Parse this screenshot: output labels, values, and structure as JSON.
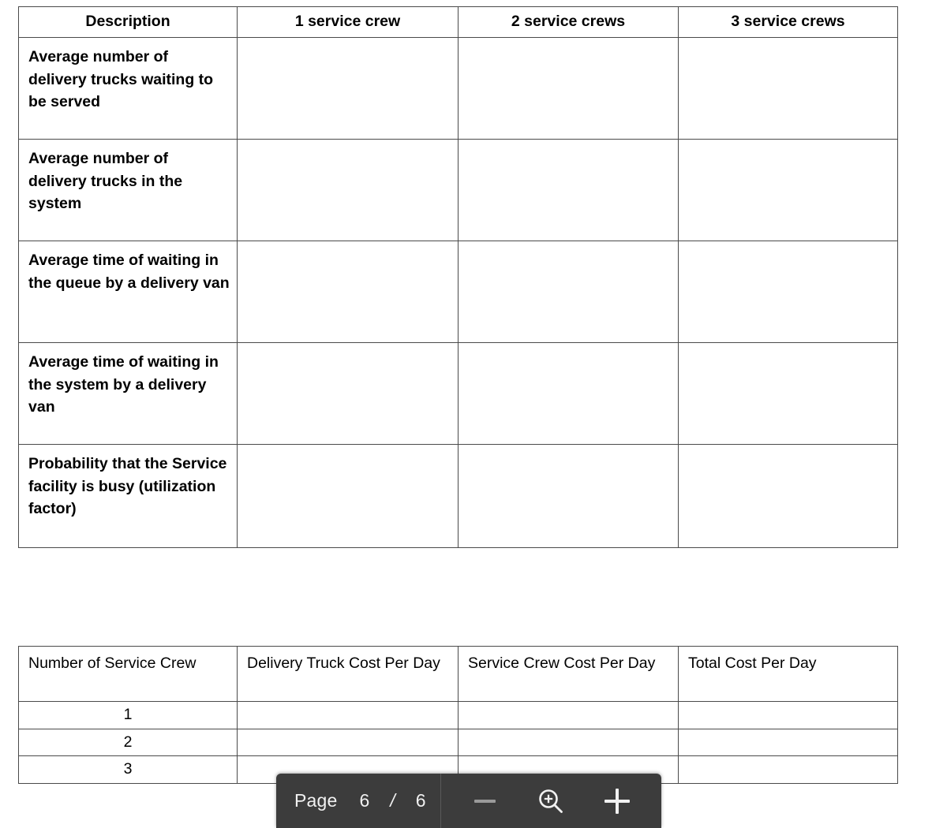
{
  "document": {
    "background_color": "#ffffff",
    "border_color": "#4a4a4a"
  },
  "metrics_table": {
    "name": "queueing-metrics-table",
    "headers": [
      "Description",
      "1 service crew",
      "2 service crews",
      "3 service crews"
    ],
    "rows": [
      {
        "description": "Average number of delivery trucks waiting to be served",
        "crew1": "",
        "crew2": "",
        "crew3": ""
      },
      {
        "description": "Average number of delivery trucks in the system",
        "crew1": "",
        "crew2": "",
        "crew3": ""
      },
      {
        "description": "Average time of waiting in the queue by a delivery van",
        "crew1": "",
        "crew2": "",
        "crew3": ""
      },
      {
        "description": "Average time of waiting in the system by a delivery van",
        "crew1": "",
        "crew2": "",
        "crew3": ""
      },
      {
        "description": "Probability that the Service facility is busy (utilization factor)",
        "crew1": "",
        "crew2": "",
        "crew3": ""
      }
    ]
  },
  "cost_table": {
    "name": "cost-comparison-table",
    "headers": [
      "Number of Service Crew",
      "Delivery Truck Cost Per Day",
      "Service Crew Cost Per Day",
      "Total Cost Per Day"
    ],
    "rows": [
      {
        "crew": "1",
        "truck_cost": "",
        "crew_cost": "",
        "total_cost": ""
      },
      {
        "crew": "2",
        "truck_cost": "",
        "crew_cost": "",
        "total_cost": ""
      },
      {
        "crew": "3",
        "truck_cost": "",
        "crew_cost": "",
        "total_cost": ""
      }
    ]
  },
  "toolbar": {
    "background_color": "#3c3c3c",
    "page_label": "Page",
    "current_page": "6",
    "separator": "/",
    "total_pages": "6",
    "zoom_out_icon": "minus-icon",
    "zoom_out_disabled": true,
    "zoom_icon": "magnifier-plus-icon",
    "zoom_in_icon": "plus-icon"
  }
}
